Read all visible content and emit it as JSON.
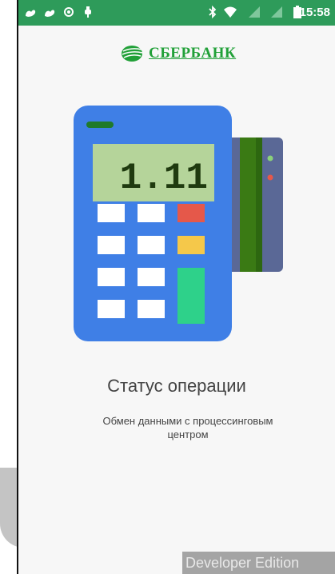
{
  "status_bar": {
    "time": "15:58",
    "icons": [
      "squirrel-icon",
      "squirrel-icon",
      "notification-icon",
      "usb-icon",
      "bluetooth-icon",
      "wifi-icon",
      "signal-icon",
      "signal-icon",
      "battery-icon"
    ]
  },
  "logo": {
    "text": "СБЕРБАНК",
    "color": "#21a038"
  },
  "terminal": {
    "display_value": "1.11",
    "body_color": "#3f7fe6",
    "card_color": "#5a6896"
  },
  "status": {
    "title": "Статус операции",
    "subtitle": "Обмен данными с процессинговым центром"
  },
  "watermark": {
    "text": "Developer Edition"
  },
  "colors": {
    "statusbar": "#2e9b5a",
    "text": "#444444",
    "background": "#f7f7f7"
  }
}
